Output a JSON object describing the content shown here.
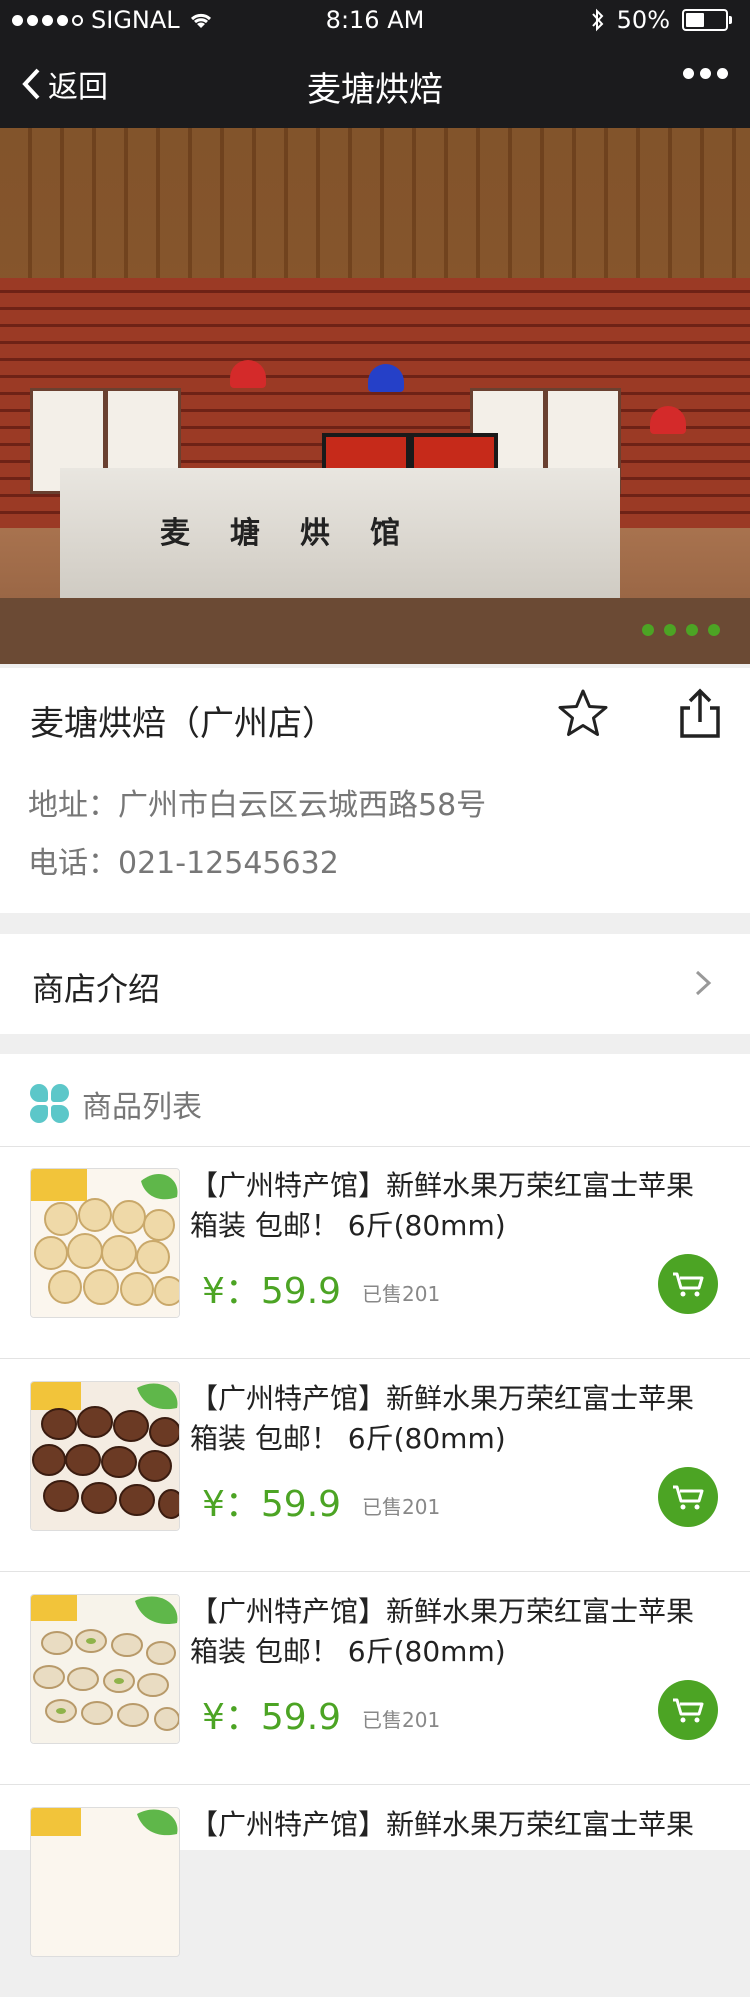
{
  "status_bar": {
    "carrier": "SIGNAL",
    "time": "8:16 AM",
    "battery": "50%"
  },
  "nav": {
    "back_label": "返回",
    "title": "麦塘烘焙"
  },
  "banner": {
    "sign_text": "麦塘烘馆",
    "active_slide": 4,
    "slide_count": 4
  },
  "store": {
    "name": "麦塘烘焙（广州店）",
    "address": "地址：广州市白云区云城西路58号",
    "phone": "电话：021-12545632"
  },
  "intro": {
    "label": "商店介绍"
  },
  "product_list": {
    "header_label": "商品列表",
    "items": [
      {
        "title": "【广州特产馆】新鲜水果万荣红富士苹果箱装 包邮！ 6斤(80mm)",
        "price": "¥：59.9",
        "sold": "已售201",
        "thumb_icon": "macadamia-nuts"
      },
      {
        "title": "【广州特产馆】新鲜水果万荣红富士苹果箱装 包邮！ 6斤(80mm)",
        "price": "¥：59.9",
        "sold": "已售201",
        "thumb_icon": "pecan-nuts"
      },
      {
        "title": "【广州特产馆】新鲜水果万荣红富士苹果箱装 包邮！ 6斤(80mm)",
        "price": "¥：59.9",
        "sold": "已售201",
        "thumb_icon": "pistachio-nuts"
      },
      {
        "title": "【广州特产馆】新鲜水果万荣红富士苹果",
        "price": "",
        "sold": "",
        "thumb_icon": "nuts"
      }
    ]
  },
  "colors": {
    "accent_green": "#4ca424",
    "nav_bg": "#1b1b1d",
    "icon_teal": "#5cc7c9"
  }
}
